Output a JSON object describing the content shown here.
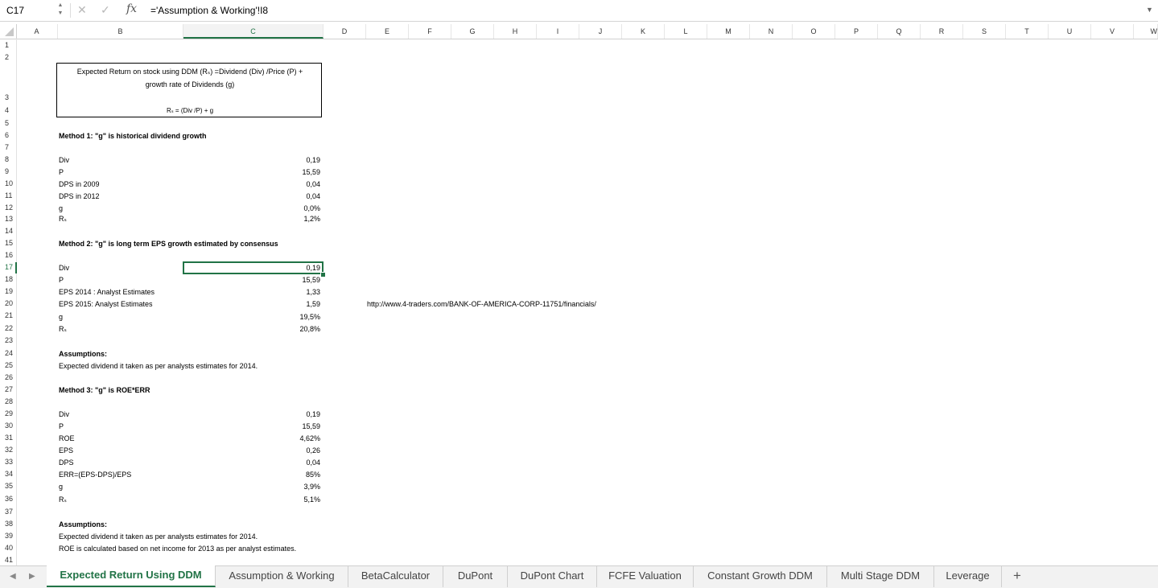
{
  "formula_bar": {
    "name_box": "C17",
    "formula": "='Assumption & Working'!I8"
  },
  "columns": [
    "A",
    "B",
    "C",
    "D",
    "E",
    "F",
    "G",
    "H",
    "I",
    "J",
    "K",
    "L",
    "M",
    "N",
    "O",
    "P",
    "Q",
    "R",
    "S",
    "T",
    "U",
    "V",
    "W"
  ],
  "selected_column": "C",
  "rows": [
    "1",
    "2",
    "3",
    "4",
    "5",
    "6",
    "7",
    "8",
    "9",
    "10",
    "11",
    "12",
    "13",
    "14",
    "15",
    "16",
    "17",
    "18",
    "19",
    "20",
    "21",
    "22",
    "23",
    "24",
    "25",
    "26",
    "27",
    "28",
    "29",
    "30",
    "31",
    "32",
    "33",
    "34",
    "35",
    "36",
    "37",
    "38",
    "39",
    "40",
    "41"
  ],
  "selected_row": "17",
  "title_box": {
    "line1": "Expected Return on stock using DDM (Rₛ) =Dividend (Div) /Price (P) +",
    "line2": "growth rate of Dividends (g)",
    "line3": "Rₛ = (Div /P) + g"
  },
  "method1": {
    "heading": "Method 1: \"g\" is historical dividend growth",
    "items": [
      {
        "label": "Div",
        "value": "0,19"
      },
      {
        "label": "P",
        "value": "15,59"
      },
      {
        "label": "DPS in 2009",
        "value": "0,04"
      },
      {
        "label": "DPS in 2012",
        "value": "0,04"
      },
      {
        "label": "g",
        "value": "0,0%"
      },
      {
        "label": "Rₛ",
        "value": "1,2%"
      }
    ]
  },
  "method2": {
    "heading": "Method 2: \"g\" is long term EPS growth estimated by consensus",
    "items": [
      {
        "label": "Div",
        "value": "0,19"
      },
      {
        "label": "P",
        "value": "15,59"
      },
      {
        "label": "EPS 2014 : Analyst Estimates",
        "value": "1,33"
      },
      {
        "label": "EPS 2015: Analyst Estimates",
        "value": "1,59"
      },
      {
        "label": "g",
        "value": "19,5%"
      },
      {
        "label": "Rₛ",
        "value": "20,8%"
      }
    ],
    "link": "http://www.4-traders.com/BANK-OF-AMERICA-CORP-11751/financials/",
    "assumptions_heading": "Assumptions:",
    "assumption1": "Expected dividend it taken as per analysts estimates for 2014."
  },
  "method3": {
    "heading": "Method 3: \"g\" is ROE*ERR",
    "items": [
      {
        "label": "Div",
        "value": "0,19"
      },
      {
        "label": "P",
        "value": "15,59"
      },
      {
        "label": "ROE",
        "value": "4,62%"
      },
      {
        "label": "EPS",
        "value": "0,26"
      },
      {
        "label": "DPS",
        "value": "0,04"
      },
      {
        "label": "ERR=(EPS-DPS)/EPS",
        "value": "85%"
      },
      {
        "label": "g",
        "value": "3,9%"
      },
      {
        "label": "Rₛ",
        "value": "5,1%"
      }
    ],
    "assumptions_heading": "Assumptions:",
    "assumption1": "Expected dividend it taken as per analysts estimates for 2014.",
    "assumption2": "ROE is calculated based on net income for 2013 as per analyst estimates."
  },
  "sheet_tabs": [
    {
      "label": "Expected Return Using DDM",
      "active": true
    },
    {
      "label": "Assumption & Working",
      "active": false
    },
    {
      "label": "BetaCalculator",
      "active": false
    },
    {
      "label": "DuPont",
      "active": false
    },
    {
      "label": "DuPont Chart",
      "active": false
    },
    {
      "label": "FCFE Valuation",
      "active": false
    },
    {
      "label": "Constant Growth DDM",
      "active": false
    },
    {
      "label": "Multi Stage DDM",
      "active": false
    },
    {
      "label": "Leverage",
      "active": false
    }
  ],
  "add_sheet_label": "+",
  "colors": {
    "accent": "#217346"
  }
}
